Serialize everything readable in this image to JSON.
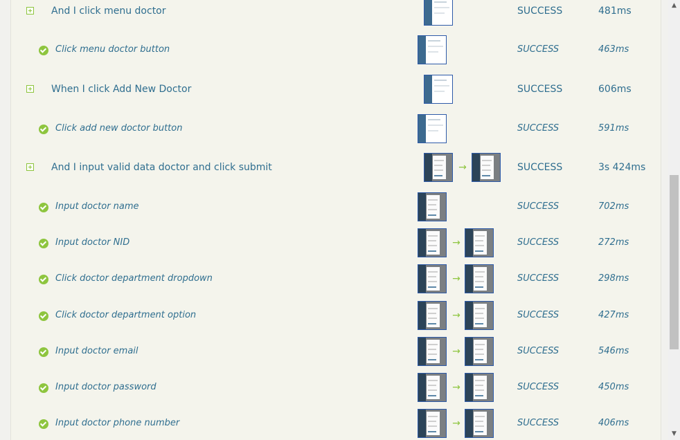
{
  "steps": [
    {
      "kind": "step",
      "label": "And I click menu doctor",
      "status": "SUCCESS",
      "duration": "481ms",
      "thumb_style": "light",
      "thumb_count": 1
    },
    {
      "kind": "sub",
      "label": "Click menu doctor button",
      "status": "SUCCESS",
      "duration": "463ms",
      "thumb_style": "light",
      "thumb_count": 1
    },
    {
      "kind": "step",
      "label": "When I click Add New Doctor",
      "status": "SUCCESS",
      "duration": "606ms",
      "thumb_style": "light",
      "thumb_count": 1
    },
    {
      "kind": "sub",
      "label": "Click add new doctor button",
      "status": "SUCCESS",
      "duration": "591ms",
      "thumb_style": "light",
      "thumb_count": 1
    },
    {
      "kind": "step",
      "label": "And I input valid data doctor and click submit",
      "status": "SUCCESS",
      "duration": "3s 424ms",
      "thumb_style": "dark",
      "thumb_count": 2
    },
    {
      "kind": "sub",
      "label": "Input doctor name",
      "status": "SUCCESS",
      "duration": "702ms",
      "thumb_style": "dark",
      "thumb_count": 1
    },
    {
      "kind": "sub",
      "label": "Input doctor NID",
      "status": "SUCCESS",
      "duration": "272ms",
      "thumb_style": "dark",
      "thumb_count": 2
    },
    {
      "kind": "sub",
      "label": "Click doctor department dropdown",
      "status": "SUCCESS",
      "duration": "298ms",
      "thumb_style": "dark",
      "thumb_count": 2
    },
    {
      "kind": "sub",
      "label": "Click doctor department option",
      "status": "SUCCESS",
      "duration": "427ms",
      "thumb_style": "dark",
      "thumb_count": 2
    },
    {
      "kind": "sub",
      "label": "Input doctor email",
      "status": "SUCCESS",
      "duration": "546ms",
      "thumb_style": "dark",
      "thumb_count": 2
    },
    {
      "kind": "sub",
      "label": "Input doctor password",
      "status": "SUCCESS",
      "duration": "450ms",
      "thumb_style": "dark",
      "thumb_count": 2
    },
    {
      "kind": "sub",
      "label": "Input doctor phone number",
      "status": "SUCCESS",
      "duration": "406ms",
      "thumb_style": "dark",
      "thumb_count": 2
    }
  ],
  "icons": {
    "expand": "plus-square-icon",
    "success": "check-circle-icon",
    "transition": "arrow-right-icon"
  },
  "colors": {
    "accent_green": "#8ec53f",
    "text_blue": "#2f6e8f",
    "thumb_border": "#2d5aa8"
  }
}
